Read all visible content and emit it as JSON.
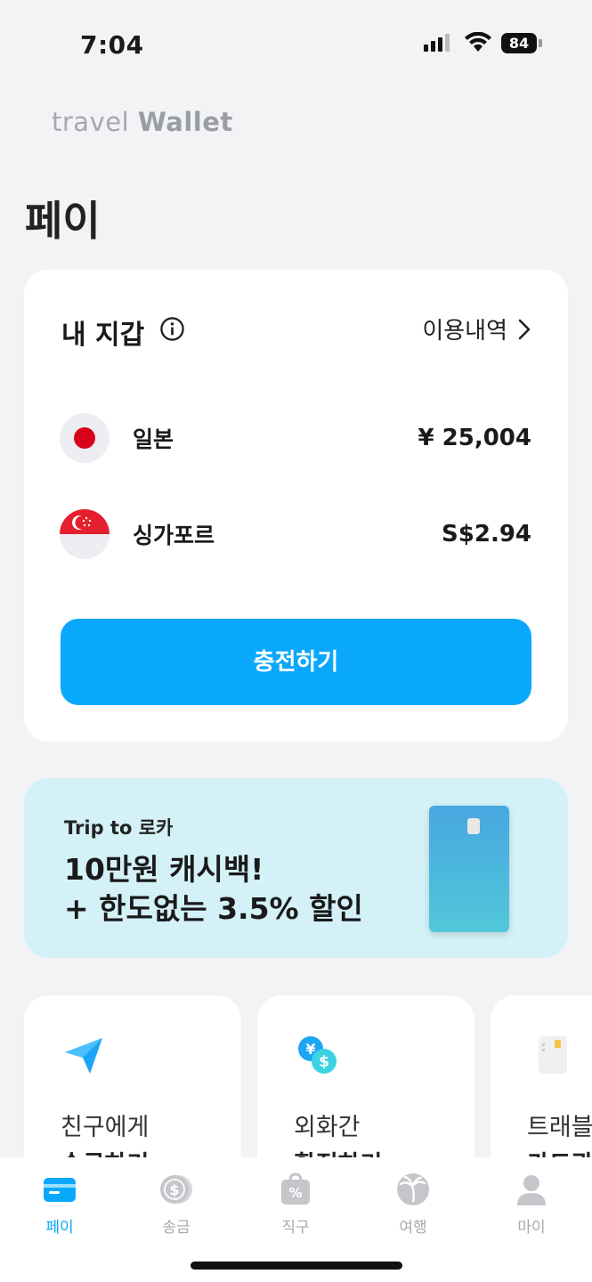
{
  "status_bar": {
    "time": "7:04",
    "battery": "84"
  },
  "brand": {
    "light": "travel ",
    "bold": "Wallet"
  },
  "page_title": "페이",
  "wallet": {
    "title": "내 지갑",
    "history_label": "이용내역",
    "currencies": [
      {
        "name": "일본",
        "amount": "¥ 25,004",
        "flag_icon": "japan-flag-icon"
      },
      {
        "name": "싱가포르",
        "amount": "S$2.94",
        "flag_icon": "singapore-flag-icon"
      }
    ],
    "charge_label": "충전하기",
    "accent_color": "#0aa8fc"
  },
  "promo": {
    "subtitle": "Trip to 로카",
    "line1": "10만원 캐시백!",
    "line2": "+ 한도없는 3.5% 할인",
    "background": "#d3f1f7"
  },
  "tiles": [
    {
      "line1": "친구에게",
      "line2": "송금하기",
      "icon": "paper-plane-icon"
    },
    {
      "line1": "외화간",
      "line2": "환전하기",
      "icon": "currency-exchange-icon"
    },
    {
      "line1": "트래블",
      "line2": "카드관리",
      "icon": "card-icon"
    }
  ],
  "tabbar": [
    {
      "label": "페이",
      "icon": "card-icon",
      "active": true
    },
    {
      "label": "송금",
      "icon": "coin-icon",
      "active": false
    },
    {
      "label": "직구",
      "icon": "shopping-bag-percent-icon",
      "active": false
    },
    {
      "label": "여행",
      "icon": "palm-tree-icon",
      "active": false
    },
    {
      "label": "마이",
      "icon": "person-icon",
      "active": false
    }
  ]
}
